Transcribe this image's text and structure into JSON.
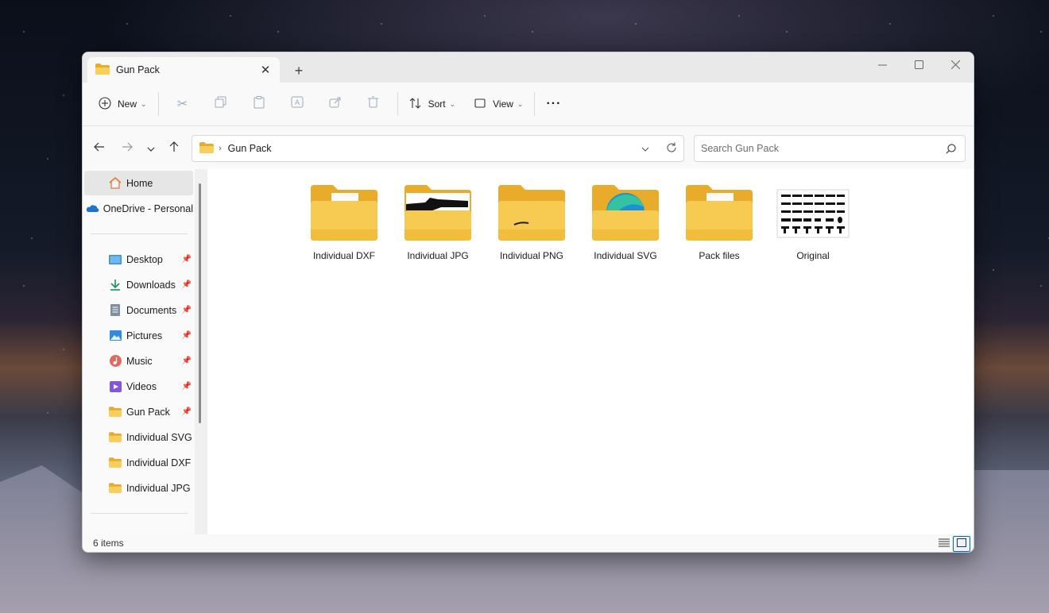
{
  "window": {
    "tab_title": "Gun Pack",
    "new_tab_symbol": "+",
    "close_tab_symbol": "✕"
  },
  "toolbar": {
    "new_label": "New",
    "sort_label": "Sort",
    "view_label": "View",
    "more_symbol": "···"
  },
  "address": {
    "separator": "›",
    "path_label": "Gun Pack",
    "search_placeholder": "Search Gun Pack"
  },
  "sidebar": {
    "home_label": "Home",
    "onedrive_label": "OneDrive - Personal",
    "pinned": [
      {
        "label": "Desktop",
        "icon": "desktop-icon"
      },
      {
        "label": "Downloads",
        "icon": "download-icon"
      },
      {
        "label": "Documents",
        "icon": "documents-icon"
      },
      {
        "label": "Pictures",
        "icon": "pictures-icon"
      },
      {
        "label": "Music",
        "icon": "music-icon"
      },
      {
        "label": "Videos",
        "icon": "videos-icon"
      },
      {
        "label": "Gun Pack",
        "icon": "folder-icon"
      },
      {
        "label": "Individual SVG",
        "icon": "folder-icon"
      },
      {
        "label": "Individual DXF",
        "icon": "folder-icon"
      },
      {
        "label": "Individual JPG",
        "icon": "folder-icon"
      }
    ]
  },
  "files": [
    {
      "name": "Individual DXF",
      "type": "folder-with-document"
    },
    {
      "name": "Individual JPG",
      "type": "folder-with-image"
    },
    {
      "name": "Individual PNG",
      "type": "folder"
    },
    {
      "name": "Individual SVG",
      "type": "folder-with-edge-icon"
    },
    {
      "name": "Pack files",
      "type": "folder-with-document"
    },
    {
      "name": "Original",
      "type": "image-thumbnail"
    }
  ],
  "status": {
    "item_count": "6 items"
  },
  "colors": {
    "folder_yellow": "#f6c544",
    "folder_back": "#e8ac2a",
    "accent": "#0067c0"
  }
}
